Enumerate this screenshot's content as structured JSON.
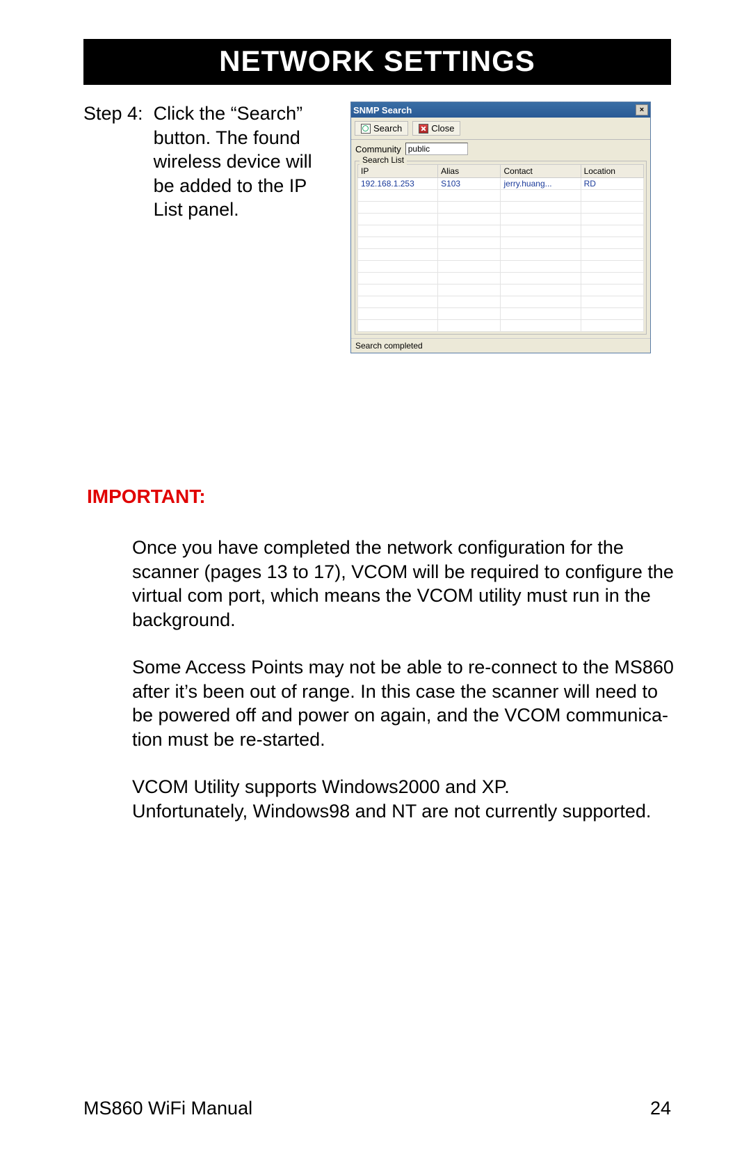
{
  "header": {
    "title": "NETWORK SETTINGS"
  },
  "step": {
    "label": "Step 4:  ",
    "text": "Click the “Search” button.  The found wireless device will be added to the IP List panel."
  },
  "snmp": {
    "title": "SNMP Search",
    "close_glyph": "×",
    "toolbar": {
      "search": "Search",
      "close": "Close"
    },
    "community_label": "Community",
    "community_value": "public",
    "search_list_label": "Search List",
    "columns": {
      "ip": "IP",
      "alias": "Alias",
      "contact": "Contact",
      "location": "Location"
    },
    "rows": [
      {
        "ip": "192.168.1.253",
        "alias": "S103",
        "contact": "jerry.huang...",
        "location": "RD"
      }
    ],
    "empty_rows": 12,
    "status": "Search completed"
  },
  "important": {
    "label": "IMPORTANT:",
    "p1": "Once you have completed the network configuration for the scanner (pages 13 to 17), VCOM will be required to configure the virtual com port, which means the VCOM utility must run in the background.",
    "p2": "Some Access Points may not be able to re-connect to the MS860 after it’s been out of range.  In this case the scanner will need to be powered off and power on again, and the VCOM communica­tion must be re-started.",
    "p3a": "VCOM Utility supports Windows2000 and XP.",
    "p3b": "Unfortunately, Windows98 and NT are not currently supported."
  },
  "footer": {
    "left": "MS860 WiFi Manual",
    "right": "24"
  }
}
